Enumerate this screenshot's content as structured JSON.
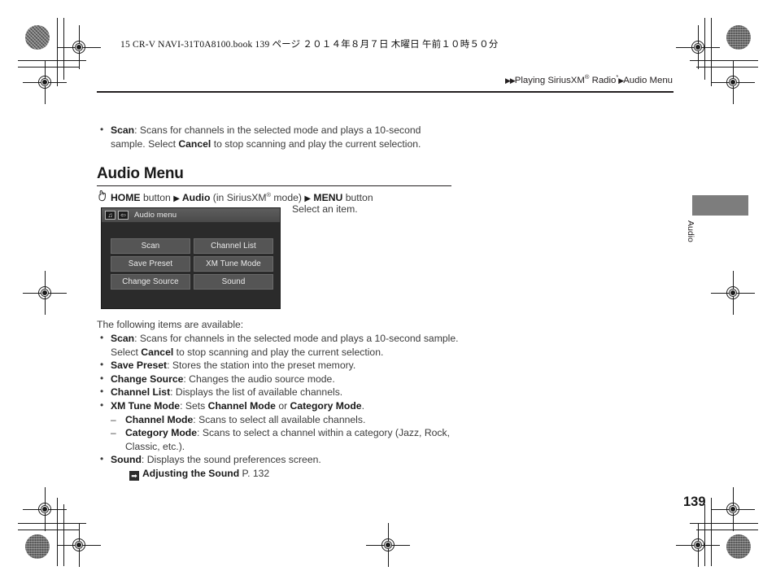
{
  "print": {
    "book_line": "15 CR-V NAVI-31T0A8100.book   139 ページ   ２０１４年８月７日   木曜日   午前１０時５０分"
  },
  "header": {
    "breadcrumb_prefix": "▶▶",
    "breadcrumb_1": "Playing SiriusXM",
    "breadcrumb_1_sup": "®",
    "breadcrumb_1_tail": " Radio",
    "breadcrumb_1_star": "*",
    "breadcrumb_sep": "▶",
    "breadcrumb_2": "Audio Menu"
  },
  "intro_bullet": {
    "term": "Scan",
    "line1": ": Scans for channels in the selected mode and plays a 10-second sample.",
    "line2_pre": "Select ",
    "line2_bold": "Cancel",
    "line2_post": " to stop scanning and play the current selection."
  },
  "section": {
    "title": "Audio Menu",
    "nav": {
      "home_bold": "HOME",
      "home_tail": " button ",
      "arrow1": "▶",
      "audio_bold": " Audio",
      "mode_text": " (in SiriusXM",
      "mode_sup": "®",
      "mode_tail": " mode) ",
      "arrow2": "▶",
      "menu_bold": " MENU",
      "menu_tail": " button"
    },
    "select_note": "Select an item."
  },
  "device_screen": {
    "title": "Audio menu",
    "icon_music": "♫",
    "icon_return": "⇦",
    "buttons": [
      "Scan",
      "Channel List",
      "Save Preset",
      "XM Tune Mode",
      "Change Source",
      "Sound"
    ]
  },
  "list": {
    "lead": "The following items are available:",
    "items": [
      {
        "term": "Scan",
        "desc": ": Scans for channels in the selected mode and plays a 10-second sample.",
        "line2_pre": "Select ",
        "line2_bold": "Cancel",
        "line2_post": " to stop scanning and play the current selection."
      },
      {
        "term": "Save Preset",
        "desc": ": Stores the station into the preset memory."
      },
      {
        "term": "Change Source",
        "desc": ": Changes the audio source mode."
      },
      {
        "term": "Channel List",
        "desc": ": Displays the list of available channels."
      },
      {
        "term": "XM Tune Mode",
        "desc_pre": ": Sets ",
        "desc_b1": "Channel Mode",
        "desc_mid": " or ",
        "desc_b2": "Category Mode",
        "desc_post": "."
      },
      {
        "term": "Sound",
        "desc": ": Displays the sound preferences screen."
      }
    ],
    "sub_items": [
      {
        "term": "Channel Mode",
        "desc": ": Scans to select all available channels."
      },
      {
        "term": "Category Mode",
        "desc": ": Scans to select a channel within a category (Jazz, Rock, Classic, etc.)."
      }
    ],
    "reference": {
      "icon": "➡",
      "label": "Adjusting the Sound",
      "page": " P. 132"
    }
  },
  "side_tab": {
    "label": "Audio"
  },
  "page_number": "139"
}
